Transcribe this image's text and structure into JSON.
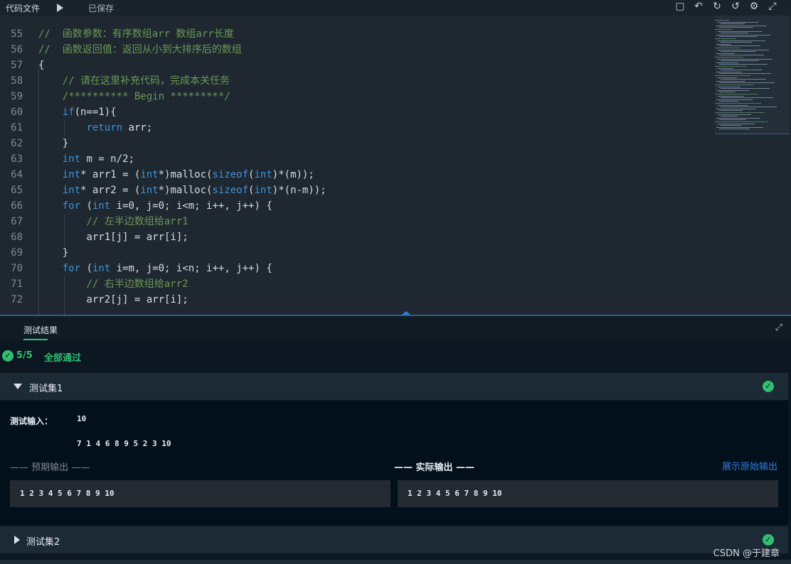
{
  "toolbar": {
    "tab_label": "代码文件",
    "status": "已保存",
    "icons": [
      "folder-icon",
      "undo-icon",
      "refresh-icon",
      "history-icon",
      "gear-icon",
      "expand-icon"
    ]
  },
  "editor": {
    "lines": [
      {
        "n": "55",
        "parts": [
          [
            "c",
            "//  函数参数：有序数组arr 数组arr长度"
          ]
        ]
      },
      {
        "n": "56",
        "parts": [
          [
            "c",
            "//  函数返回值：返回从小到大排序后的数组"
          ]
        ]
      },
      {
        "n": "57",
        "parts": [
          [
            "t",
            "{"
          ]
        ]
      },
      {
        "n": "58",
        "parts": [
          [
            "t",
            "    "
          ],
          [
            "c",
            "// 请在这里补充代码，完成本关任务"
          ]
        ]
      },
      {
        "n": "59",
        "parts": [
          [
            "t",
            "    "
          ],
          [
            "c",
            "/********** Begin *********/"
          ]
        ]
      },
      {
        "n": "60",
        "parts": [
          [
            "t",
            "    "
          ],
          [
            "k",
            "if"
          ],
          [
            "t",
            "(n==1){"
          ]
        ]
      },
      {
        "n": "61",
        "parts": [
          [
            "t",
            "        "
          ],
          [
            "k",
            "return"
          ],
          [
            "t",
            " arr;"
          ]
        ]
      },
      {
        "n": "62",
        "parts": [
          [
            "t",
            "    }"
          ]
        ]
      },
      {
        "n": "63",
        "parts": [
          [
            "t",
            "    "
          ],
          [
            "k",
            "int"
          ],
          [
            "t",
            " m = n/2;"
          ]
        ]
      },
      {
        "n": "64",
        "parts": [
          [
            "t",
            "    "
          ],
          [
            "k",
            "int"
          ],
          [
            "t",
            "* arr1 = ("
          ],
          [
            "k",
            "int"
          ],
          [
            "t",
            "*)malloc("
          ],
          [
            "k",
            "sizeof"
          ],
          [
            "t",
            "("
          ],
          [
            "k",
            "int"
          ],
          [
            "t",
            ")*(m));"
          ]
        ]
      },
      {
        "n": "65",
        "parts": [
          [
            "t",
            "    "
          ],
          [
            "k",
            "int"
          ],
          [
            "t",
            "* arr2 = ("
          ],
          [
            "k",
            "int"
          ],
          [
            "t",
            "*)malloc("
          ],
          [
            "k",
            "sizeof"
          ],
          [
            "t",
            "("
          ],
          [
            "k",
            "int"
          ],
          [
            "t",
            ")*(n-m));"
          ]
        ]
      },
      {
        "n": "66",
        "parts": [
          [
            "t",
            "    "
          ],
          [
            "k",
            "for"
          ],
          [
            "t",
            " ("
          ],
          [
            "k",
            "int"
          ],
          [
            "t",
            " i=0, j=0; i<m; i++, j++) {"
          ]
        ]
      },
      {
        "n": "67",
        "parts": [
          [
            "t",
            "        "
          ],
          [
            "c",
            "// 左半边数组给arr1"
          ]
        ]
      },
      {
        "n": "68",
        "parts": [
          [
            "t",
            "        arr1[j] = arr[i];"
          ]
        ]
      },
      {
        "n": "69",
        "parts": [
          [
            "t",
            "    }"
          ]
        ]
      },
      {
        "n": "70",
        "parts": [
          [
            "t",
            "    "
          ],
          [
            "k",
            "for"
          ],
          [
            "t",
            " ("
          ],
          [
            "k",
            "int"
          ],
          [
            "t",
            " i=m, j=0; i<n; i++, j++) {"
          ]
        ]
      },
      {
        "n": "71",
        "parts": [
          [
            "t",
            "        "
          ],
          [
            "c",
            "// 右半边数组给arr2"
          ]
        ]
      },
      {
        "n": "72",
        "parts": [
          [
            "t",
            "        arr2[j] = arr[i];"
          ]
        ]
      }
    ]
  },
  "results": {
    "tab_label": "测试结果",
    "summary_count": "5/5",
    "summary_text": "全部通过",
    "sets": [
      {
        "label": "测试集1",
        "input_label": "测试输入：",
        "input_lines": [
          "10",
          "7 1 4 6 8 9 5 2 3 10"
        ],
        "expected_label": "—— 预期输出 ——",
        "actual_label": "—— 实际输出 ——",
        "raw_link": "展示原始输出",
        "expected_output": "1 2 3 4 5 6 7 8 9 10",
        "actual_output": "1 2 3 4 5 6 7 8 9 10"
      },
      {
        "label": "测试集2"
      }
    ]
  },
  "watermark": "CSDN @于建章",
  "colors": {
    "accent_green": "#2fbf71",
    "link_blue": "#2f7de1",
    "comment": "#6a9955",
    "keyword": "#3e93d8"
  }
}
